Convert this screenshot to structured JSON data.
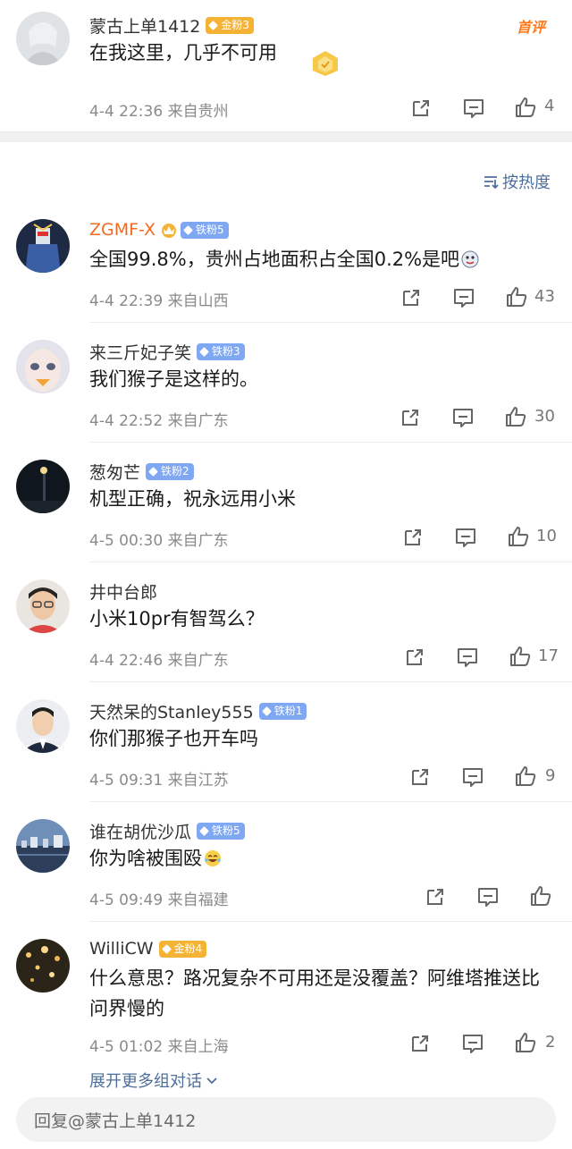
{
  "original": {
    "username": "蒙古上单1412",
    "badge": "金粉3",
    "hot_tag": "首评",
    "text": "在我这里，几乎不可用",
    "meta": "4-4 22:36  来自贵州",
    "likes": "4"
  },
  "sort_label": "按热度",
  "comments": [
    {
      "username": "ZGMF-X",
      "badge": "铁粉5",
      "text": "全国99.8%，贵州占地面积占全国0.2%是吧",
      "meta": "4-4 22:39  来自山西",
      "likes": "43"
    },
    {
      "username": "来三斤妃子笑",
      "badge": "铁粉3",
      "text": "我们猴子是这样的。",
      "meta": "4-4 22:52  来自广东",
      "likes": "30"
    },
    {
      "username": "葱匆芒",
      "badge": "铁粉2",
      "text": "机型正确，祝永远用小米",
      "meta": "4-5 00:30  来自广东",
      "likes": "10"
    },
    {
      "username": "井中台郎",
      "badge": "",
      "text": "小米10pr有智驾么？",
      "meta": "4-4 22:46  来自广东",
      "likes": "17"
    },
    {
      "username": "天然呆的Stanley555",
      "badge": "铁粉1",
      "text": "你们那猴子也开车吗",
      "meta": "4-5 09:31  来自江苏",
      "likes": "9"
    },
    {
      "username": "谁在胡优沙瓜",
      "badge": "铁粉5",
      "text": "你为啥被围殴",
      "meta": "4-5 09:49  来自福建",
      "likes": ""
    },
    {
      "username": "WilliCW",
      "badge": "金粉4",
      "text": "什么意思？路况复杂不可用还是没覆盖？阿维塔推送比问界慢的",
      "meta": "4-5 01:02  来自上海",
      "likes": "2"
    }
  ],
  "expand_label": "展开更多组对话",
  "reply_placeholder": "回复@蒙古上单1412",
  "colors": {
    "link_blue": "#4e6f9b",
    "iron_badge": "#7fa7f2",
    "gold_badge": "#f5b335",
    "vip_name": "#f46b1f",
    "meta_gray": "#8a8a8a"
  },
  "icons": [
    "share-icon",
    "comment-icon",
    "thumbs-up-icon",
    "sort-icon",
    "chevron-down-icon",
    "crown-icon",
    "emoji-icon"
  ]
}
